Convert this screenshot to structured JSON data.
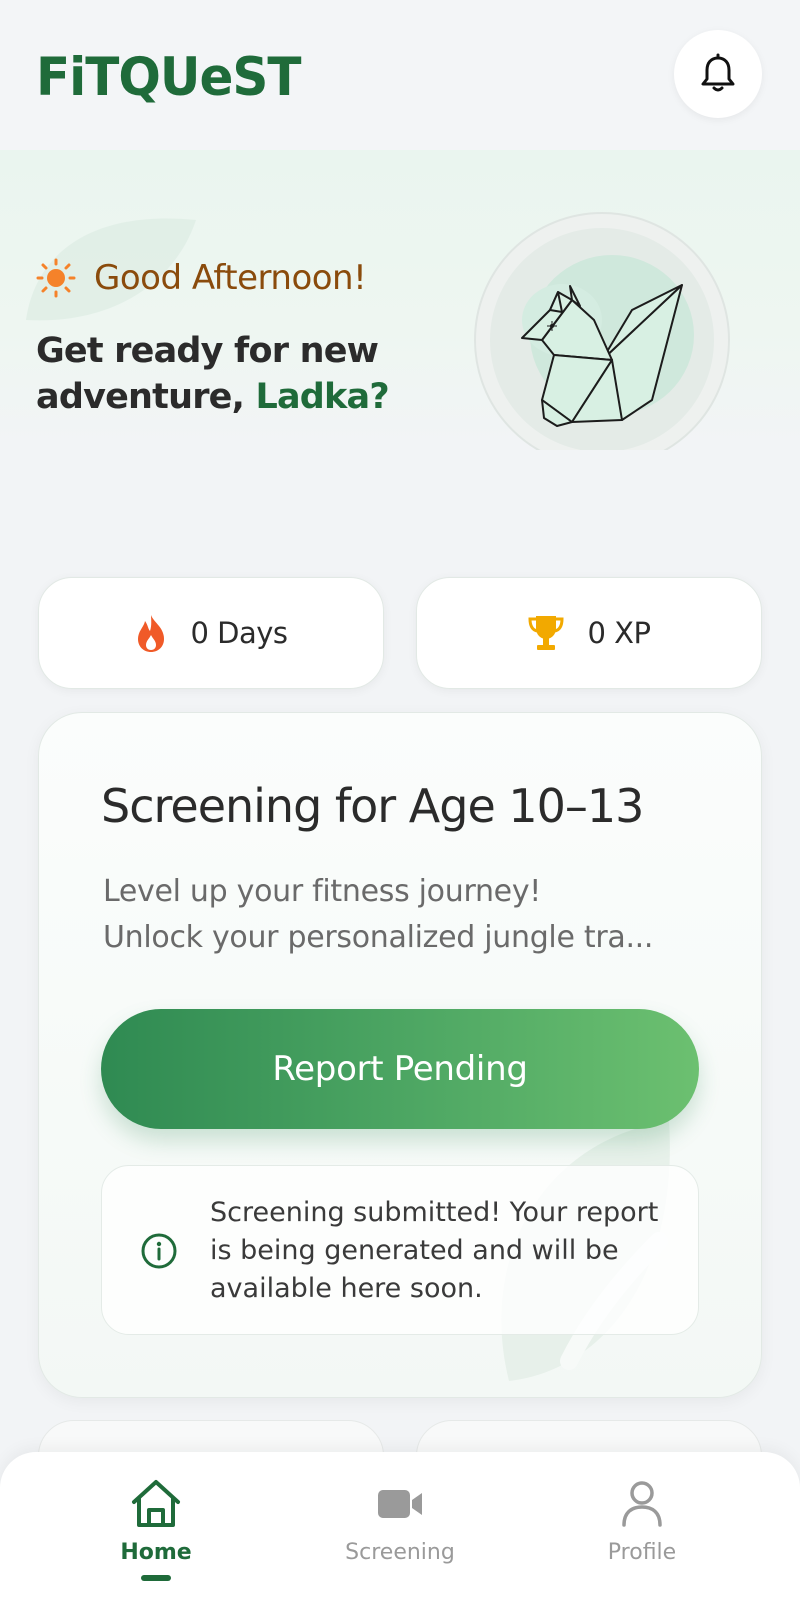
{
  "app": {
    "logo": "FiTQUeST"
  },
  "header": {
    "notifications_icon": "bell-icon"
  },
  "hero": {
    "greeting": "Good Afternoon!",
    "title_prefix": "Get ready for new adventure, ",
    "user_name": "Ladka",
    "title_suffix": "?",
    "avatar": "origami-squirrel-illustration"
  },
  "stats": [
    {
      "icon": "flame-icon",
      "value": "0 Days",
      "color": "#f05a28"
    },
    {
      "icon": "trophy-icon",
      "value": "0 XP",
      "color": "#f2a900"
    }
  ],
  "screening_card": {
    "title": "Screening for Age 10–13",
    "description_line1": "Level up your fitness journey!",
    "description_line2": "Unlock your personalized jungle tra...",
    "cta_label": "Report Pending",
    "info_icon": "info-icon",
    "info_text": "Screening submitted! Your report is being generated and will be available here soon."
  },
  "bottom_nav": {
    "items": [
      {
        "label": "Home",
        "icon": "home-icon",
        "active": true
      },
      {
        "label": "Screening",
        "icon": "video-camera-icon",
        "active": false
      },
      {
        "label": "Profile",
        "icon": "user-icon",
        "active": false
      }
    ]
  },
  "colors": {
    "brand_green": "#1f6b3a",
    "greeting_brown": "#8a4b0c",
    "cta_gradient_start": "#2f8a52",
    "cta_gradient_end": "#6cc070",
    "background": "#f2f4f6"
  }
}
